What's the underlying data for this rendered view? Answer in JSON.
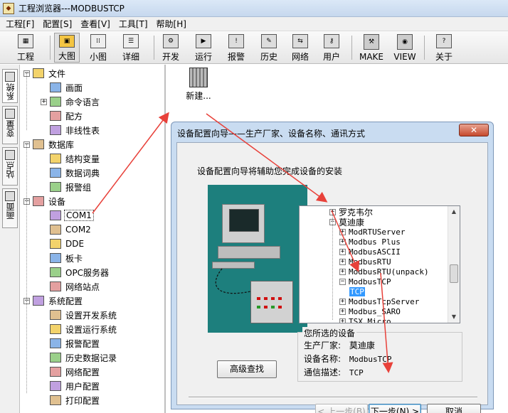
{
  "window": {
    "title": "工程浏览器---MODBUSTCP",
    "icon": "app-icon"
  },
  "menu": [
    "工程[F]",
    "配置[S]",
    "查看[V]",
    "工具[T]",
    "帮助[H]"
  ],
  "toolbar": [
    {
      "label": "工程",
      "icon": "project-icon"
    },
    {
      "label": "大图",
      "icon": "large-icon-view-icon",
      "active": true
    },
    {
      "label": "小图",
      "icon": "small-icon-view-icon"
    },
    {
      "label": "详细",
      "icon": "details-view-icon"
    },
    {
      "label": "开发",
      "icon": "develop-icon"
    },
    {
      "label": "运行",
      "icon": "run-icon"
    },
    {
      "label": "报警",
      "icon": "alarm-icon"
    },
    {
      "label": "历史",
      "icon": "history-icon"
    },
    {
      "label": "网络",
      "icon": "network-icon"
    },
    {
      "label": "用户",
      "icon": "user-key-icon"
    },
    {
      "label": "MAKE",
      "icon": "make-icon"
    },
    {
      "label": "VIEW",
      "icon": "view-icon"
    },
    {
      "label": "关于",
      "icon": "about-icon"
    }
  ],
  "vtabs": [
    "系统",
    "变量",
    "站点",
    "画面"
  ],
  "tree": [
    {
      "label": "文件",
      "level": 0,
      "exp": "−",
      "icon": "folder-icon"
    },
    {
      "label": "画面",
      "level": 1,
      "icon": "screen-icon"
    },
    {
      "label": "命令语言",
      "level": 1,
      "exp": "+",
      "icon": "command-icon"
    },
    {
      "label": "配方",
      "level": 1,
      "icon": "recipe-icon"
    },
    {
      "label": "非线性表",
      "level": 1,
      "icon": "nonlinear-table-icon"
    },
    {
      "label": "数据库",
      "level": 0,
      "exp": "−",
      "icon": "database-icon"
    },
    {
      "label": "结构变量",
      "level": 1,
      "icon": "struct-var-icon"
    },
    {
      "label": "数据词典",
      "level": 1,
      "icon": "dictionary-icon"
    },
    {
      "label": "报警组",
      "level": 1,
      "icon": "alarm-group-icon"
    },
    {
      "label": "设备",
      "level": 0,
      "exp": "−",
      "icon": "device-icon"
    },
    {
      "label": "COM1",
      "level": 1,
      "icon": "com-port-icon",
      "selected": true
    },
    {
      "label": "COM2",
      "level": 1,
      "icon": "com-port-icon"
    },
    {
      "label": "DDE",
      "level": 1,
      "icon": "dde-icon"
    },
    {
      "label": "板卡",
      "level": 1,
      "icon": "board-card-icon"
    },
    {
      "label": "OPC服务器",
      "level": 1,
      "icon": "opc-server-icon"
    },
    {
      "label": "网络站点",
      "level": 1,
      "icon": "network-station-icon"
    },
    {
      "label": "系统配置",
      "level": 0,
      "exp": "−",
      "icon": "system-config-icon"
    },
    {
      "label": "设置开发系统",
      "level": 1,
      "icon": "dev-system-icon"
    },
    {
      "label": "设置运行系统",
      "level": 1,
      "icon": "run-system-icon"
    },
    {
      "label": "报警配置",
      "level": 1,
      "icon": "alarm-config-icon"
    },
    {
      "label": "历史数据记录",
      "level": 1,
      "icon": "history-record-icon"
    },
    {
      "label": "网络配置",
      "level": 1,
      "icon": "network-config-icon"
    },
    {
      "label": "用户配置",
      "level": 1,
      "icon": "user-config-icon"
    },
    {
      "label": "打印配置",
      "level": 1,
      "icon": "print-config-icon"
    }
  ],
  "new_item": {
    "label": "新建..."
  },
  "dialog": {
    "title": "设备配置向导——生产厂家、设备名称、通讯方式",
    "intro": "设备配置向导将辅助您完成设备的安装",
    "advanced_button": "高级查找",
    "device_tree": [
      {
        "label": "罗克韦尔",
        "level": 0,
        "exp": "+",
        "cjk": true
      },
      {
        "label": "莫迪康",
        "level": 0,
        "exp": "−",
        "cjk": true
      },
      {
        "label": "ModRTUServer",
        "level": 1,
        "exp": "+"
      },
      {
        "label": "Modbus Plus",
        "level": 1,
        "exp": "+"
      },
      {
        "label": "ModbusASCII",
        "level": 1,
        "exp": "+"
      },
      {
        "label": "ModbusRTU",
        "level": 1,
        "exp": "+"
      },
      {
        "label": "ModbusRTU(unpack)",
        "level": 1,
        "exp": "+"
      },
      {
        "label": "ModbusTCP",
        "level": 1,
        "exp": "−"
      },
      {
        "label": "TCP",
        "level": 2,
        "selected": true
      },
      {
        "label": "ModbusTcpServer",
        "level": 1,
        "exp": "+"
      },
      {
        "label": "Modbus_SARO",
        "level": 1,
        "exp": "+"
      },
      {
        "label": "TSX Micro",
        "level": 1,
        "exp": "+"
      }
    ],
    "selected_group": {
      "title": "您所选的设备",
      "rows": [
        {
          "label": "生产厂家:",
          "value": "莫迪康",
          "cjk": true
        },
        {
          "label": "设备名称:",
          "value": "ModbusTCP"
        },
        {
          "label": "通信描述:",
          "value": "TCP"
        }
      ]
    },
    "buttons": {
      "back": "< 上一步(B)",
      "next": "下一步(N) >",
      "cancel": "取消"
    }
  }
}
